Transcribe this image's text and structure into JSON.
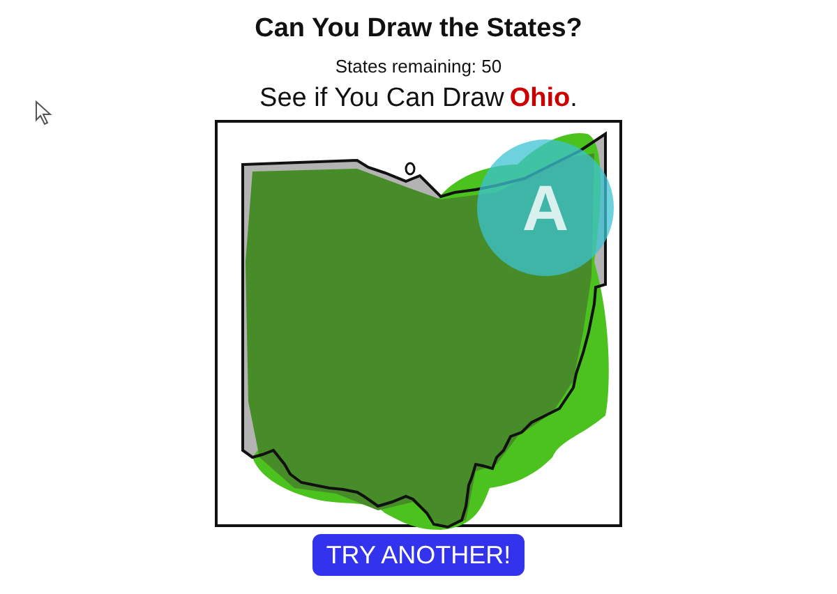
{
  "title": "Can You Draw the States?",
  "remaining": "States remaining: 50",
  "prompt": {
    "before": "See if You Can Draw",
    "state": "Ohio",
    "after": "."
  },
  "canvas": {
    "touch_label": "A"
  },
  "button": "TRY ANOTHER!"
}
